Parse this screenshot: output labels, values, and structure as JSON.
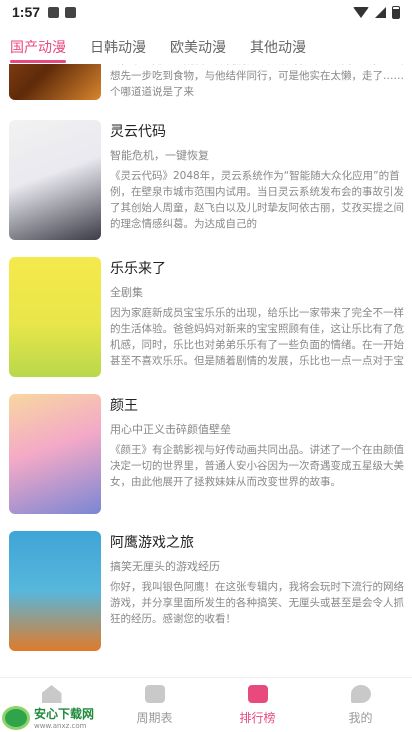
{
  "status_bar": {
    "time": "1:57"
  },
  "tabs": [
    {
      "label": "国产动漫",
      "active": true
    },
    {
      "label": "日韩动漫",
      "active": false
    },
    {
      "label": "欧美动漫",
      "active": false
    },
    {
      "label": "其他动漫",
      "active": false
    }
  ],
  "items": [
    {
      "title": "",
      "subtitle": "",
      "desc": "云，谁想竟是屋荒庙。师徒们师父要饭时，外出去找吃食，八戒想先一步吃到食物，与他结伴同行，可是他实在太懒，走了……个哪道道说是了来"
    },
    {
      "title": "灵云代码",
      "subtitle": "智能危机，一键恢复",
      "desc": "《灵云代码》2048年，灵云系统作为“智能随大众化应用”的首例，在壁泉市城市范围内试用。当日灵云系统发布会的事故引发了其创始人周童，赵飞白以及儿时挚友阿依古丽，艾孜买提之间的理念情感纠葛。为达成自己的"
    },
    {
      "title": "乐乐来了",
      "subtitle": "全剧集",
      "desc": "因为家庭新成员宝宝乐乐的出现，给乐比一家带来了完全不一样的生活体验。爸爸妈妈对新来的宝宝照顾有佳，这让乐比有了危机感，同时，乐比也对弟弟乐乐有了一些负面的情绪。在一开始甚至不喜欢乐乐。但是随着剧情的发展，乐比也一点一点对于宝宝的关爱和认同"
    },
    {
      "title": "颜王",
      "subtitle": "用心中正义击碎颜值壁垒",
      "desc": "《颜王》有企鹅影视与好传动画共同出品。讲述了一个在由颜值决定一切的世界里，普通人安小谷因为一次奇遇变成五星级大美女，由此他展开了拯救妹妹从而改变世界的故事。"
    },
    {
      "title": "阿鹰游戏之旅",
      "subtitle": "搞笑无厘头的游戏经历",
      "desc": "你好，我叫银色阿鹰！在这张专辑内，我将会玩时下流行的网络游戏，并分享里面所发生的各种搞笑、无厘头或甚至是会令人抓狂的经历。感谢您的收看！"
    }
  ],
  "bottom_nav": [
    {
      "label": "",
      "icon": "home-icon",
      "active": false
    },
    {
      "label": "周期表",
      "icon": "calendar-icon",
      "active": false
    },
    {
      "label": "排行榜",
      "icon": "ranking-icon",
      "active": true
    },
    {
      "label": "我的",
      "icon": "profile-icon",
      "active": false
    }
  ],
  "watermark": {
    "title": "安心下载网",
    "url": "www.anxz.com"
  },
  "colors": {
    "accent": "#e84a7d"
  }
}
